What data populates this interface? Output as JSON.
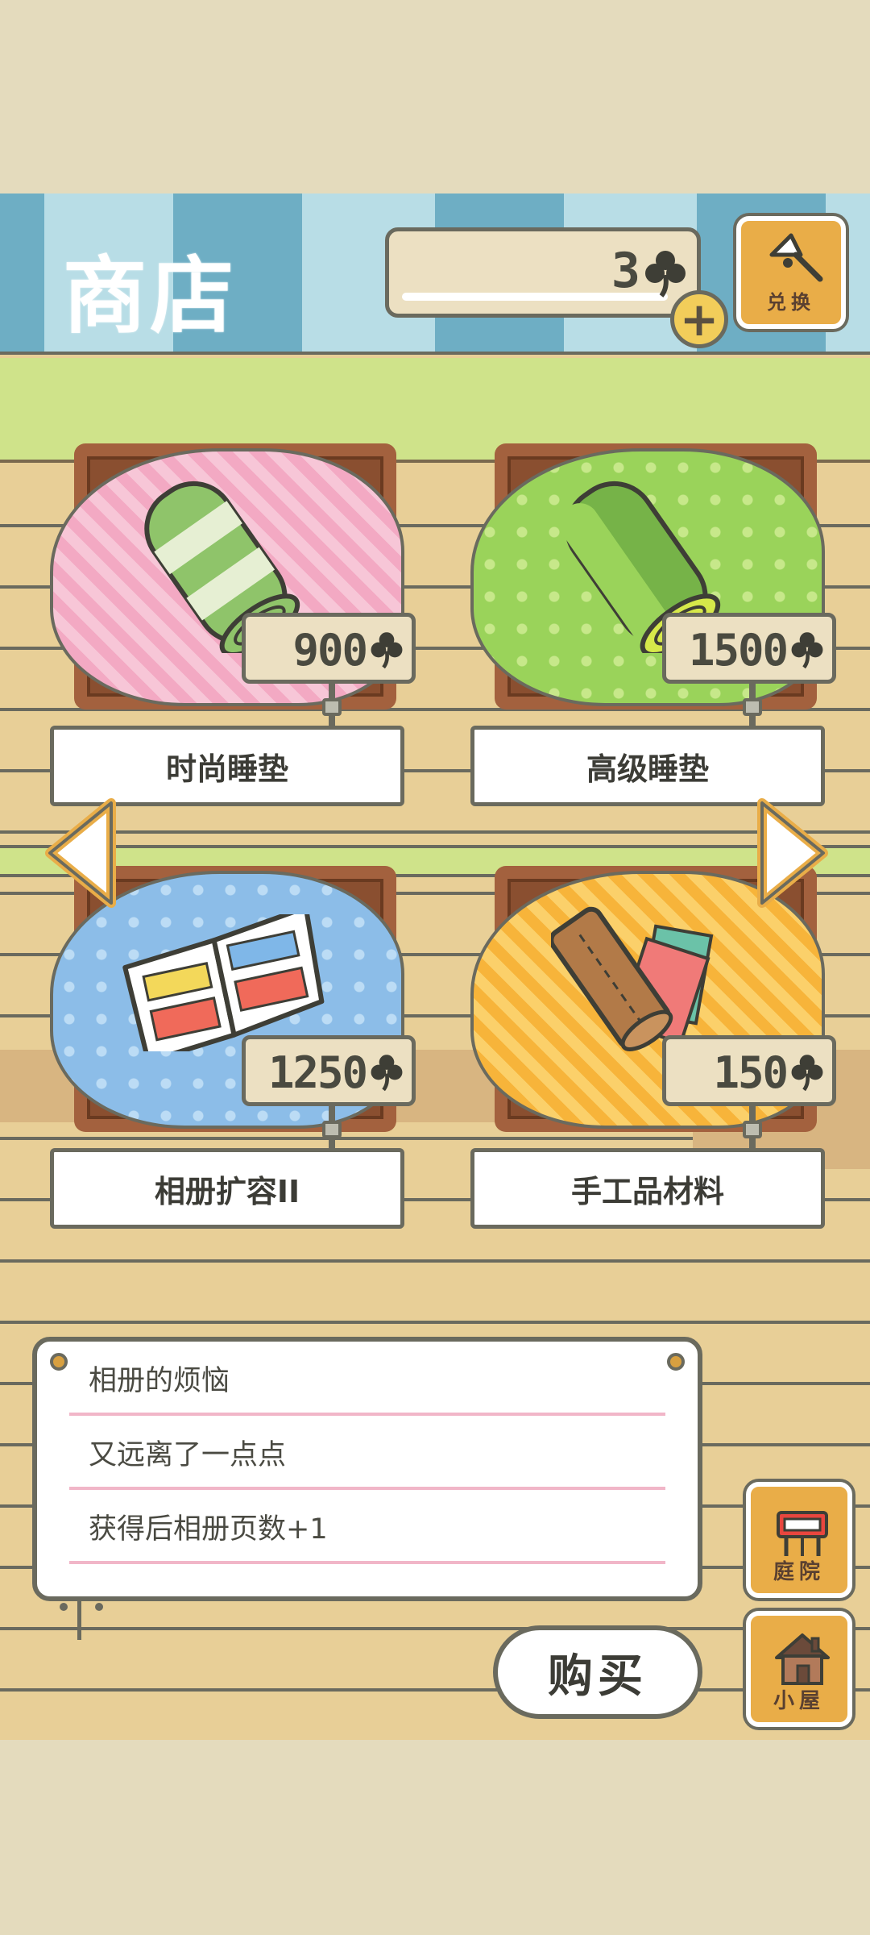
{
  "header": {
    "title": "商店",
    "currency": {
      "value": "3",
      "icon": "clover-icon"
    },
    "add_button": {
      "label": "+",
      "icon": "plus-icon"
    },
    "exchange_button": {
      "label": "兑换",
      "icon": "key-icon"
    }
  },
  "items": [
    {
      "name": "时尚睡垫",
      "price": "900",
      "art": "pink-sleeping-mat",
      "cloth_color": "#f3a9c3"
    },
    {
      "name": "高级睡垫",
      "price": "1500",
      "art": "green-sleeping-mat",
      "cloth_color": "#9ad35a"
    },
    {
      "name": "相册扩容II",
      "price": "1250",
      "art": "photo-album",
      "cloth_color": "#8cbde8"
    },
    {
      "name": "手工品材料",
      "price": "150",
      "art": "craft-materials",
      "cloth_color": "#f7b43a"
    }
  ],
  "nav": {
    "prev": "left-arrow-icon",
    "next": "right-arrow-icon"
  },
  "description": {
    "lines": [
      "相册的烦恼",
      "又远离了一点点",
      "获得后相册页数+1"
    ]
  },
  "buy_button": {
    "label": "购买"
  },
  "side_buttons": {
    "garden": {
      "label": "庭院",
      "icon": "garden-gate-icon"
    },
    "house": {
      "label": "小屋",
      "icon": "house-icon"
    }
  },
  "colors": {
    "header_light": "#b8dde6",
    "header_dark": "#6eaec4",
    "green_band": "#cfe38a",
    "wood": "#e8cf97",
    "button_orange": "#e9ad48",
    "outline": "#6a6a5e"
  }
}
